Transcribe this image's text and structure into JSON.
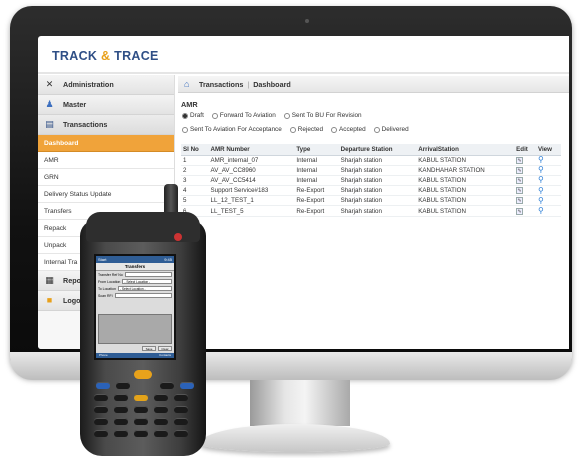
{
  "app": {
    "logo_left": "Track ",
    "logo_amp": "&",
    "logo_right": " Trace"
  },
  "sidebar": {
    "menus": [
      {
        "label": "Administration",
        "icon": "tools-icon"
      },
      {
        "label": "Master",
        "icon": "master-icon"
      },
      {
        "label": "Transactions",
        "icon": "transactions-icon"
      }
    ],
    "subitems": [
      "Dashboard",
      "AMR",
      "GRN",
      "Delivery Status Update",
      "Transfers",
      "Repack",
      "Unpack",
      "Internal Tra"
    ],
    "selected_subitem": "Dashboard",
    "lower_menus": [
      {
        "label": "Repo",
        "icon": "reports-icon"
      },
      {
        "label": "Logo",
        "icon": "logout-icon"
      }
    ]
  },
  "breadcrumb": {
    "section": "Transactions",
    "sep": "|",
    "page": "Dashboard"
  },
  "section_title": "AMR",
  "status_filters": {
    "row1": [
      "Draft",
      "Forward To Aviation",
      "Sent To BU For Revision"
    ],
    "row2": [
      "Sent To Aviation For Acceptance",
      "Rejected",
      "Accepted",
      "Delivered"
    ],
    "selected": "Draft"
  },
  "table": {
    "columns": [
      "Sl No",
      "AMR Number",
      "Type",
      "Departure Station",
      "ArrivalStation",
      "Edit",
      "View"
    ],
    "rows": [
      [
        "1",
        "AMR_internal_07",
        "Internal",
        "Sharjah station",
        "KABUL STATION"
      ],
      [
        "2",
        "AV_AV_CC8960",
        "Internal",
        "Sharjah station",
        "KANDHAHAR STATION"
      ],
      [
        "3",
        "AV_AV_CC5414",
        "Internal",
        "Sharjah station",
        "KABUL STATION"
      ],
      [
        "4",
        "Support Service#183",
        "Re-Export",
        "Sharjah station",
        "KABUL STATION"
      ],
      [
        "5",
        "LL_12_TEST_1",
        "Re-Export",
        "Sharjah station",
        "KABUL STATION"
      ],
      [
        "6",
        "LL_TEST_5",
        "Re-Export",
        "Sharjah station",
        "KABUL STATION"
      ]
    ]
  },
  "device": {
    "status_left": "Start",
    "status_right": "9:45",
    "title": "Transfers",
    "fields": [
      {
        "label": "Transfer Ref No",
        "value": ""
      },
      {
        "label": "From Location",
        "value": "- Select Location -"
      },
      {
        "label": "To Location",
        "value": "- Select Location -"
      },
      {
        "label": "Scan RFI",
        "value": ""
      }
    ],
    "buttons": [
      "Save",
      "Clear"
    ],
    "foot_left": "Phone",
    "foot_right": "Contacts"
  },
  "colors": {
    "accent": "#f0a33a",
    "brand_blue": "#2f4f86",
    "view_blue": "#2e7fd6"
  }
}
